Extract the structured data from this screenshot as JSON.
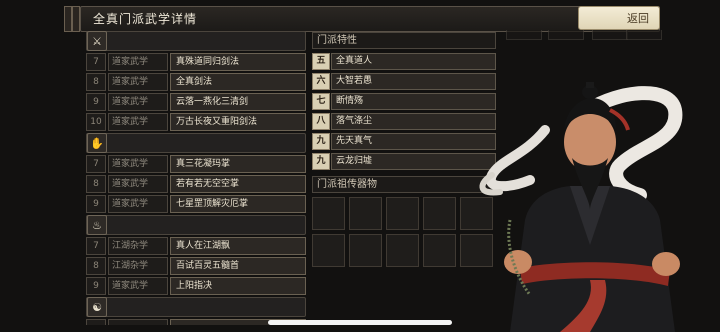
{
  "header": {
    "title": "全真门派武学详情",
    "back_label": "返回"
  },
  "categories": [
    {
      "icon": "sword-icon",
      "glyph": "⚔",
      "items": [
        {
          "level": "7",
          "type": "道家武学",
          "name": "真殊道同归剑法"
        },
        {
          "level": "8",
          "type": "道家武学",
          "name": "全真剑法"
        },
        {
          "level": "9",
          "type": "道家武学",
          "name": "云落一燕化三清剑"
        },
        {
          "level": "10",
          "type": "道家武学",
          "name": "万古长夜又重阳剑法"
        }
      ]
    },
    {
      "icon": "palm-icon",
      "glyph": "✋",
      "items": [
        {
          "level": "7",
          "type": "道家武学",
          "name": "真三花凝玛掌"
        },
        {
          "level": "8",
          "type": "道家武学",
          "name": "若有若无空空掌"
        },
        {
          "level": "9",
          "type": "道家武学",
          "name": "七星罡顶解灾厄掌"
        }
      ]
    },
    {
      "icon": "flame-icon",
      "glyph": "♨",
      "items": [
        {
          "level": "7",
          "type": "江湖杂学",
          "name": "真人在江湖飘"
        },
        {
          "level": "8",
          "type": "江湖杂学",
          "name": "百试百灵五髓首"
        },
        {
          "level": "9",
          "type": "道家武学",
          "name": "上阳指决"
        }
      ]
    },
    {
      "icon": "yin-yang-icon",
      "glyph": "☯",
      "items": []
    }
  ],
  "traits": {
    "title": "门派特性",
    "items": [
      {
        "badge": "五",
        "name": "全真道人"
      },
      {
        "badge": "六",
        "name": "大智若愚"
      },
      {
        "badge": "七",
        "name": "断情殇"
      },
      {
        "badge": "八",
        "name": "落气涤尘"
      },
      {
        "badge": "九",
        "name": "先天真气"
      },
      {
        "badge": "九",
        "name": "云龙归墟"
      }
    ]
  },
  "treasures": {
    "title": "门派祖传器物"
  },
  "colors": {
    "accent": "#e6dcc0",
    "panel": "#2c2824",
    "border": "#5d564a"
  }
}
